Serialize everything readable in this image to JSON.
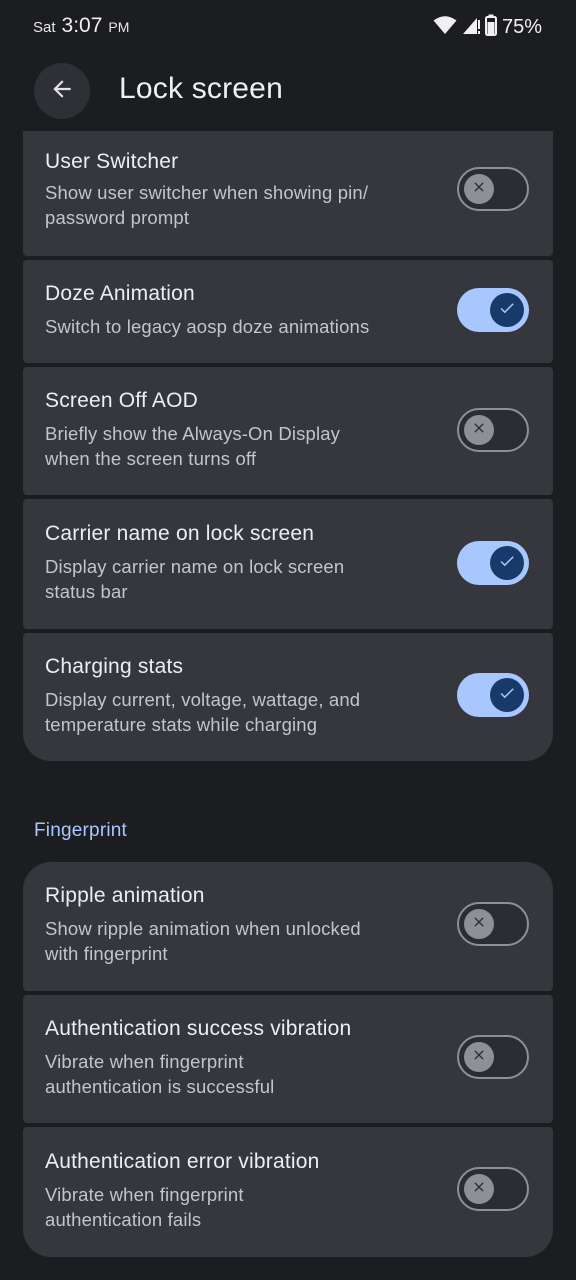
{
  "status_bar": {
    "day": "Sat",
    "time": "3:07",
    "ampm": "PM",
    "battery_percent": "75%",
    "icons": [
      "wifi-icon",
      "signal-icon",
      "battery-icon"
    ]
  },
  "header": {
    "back_icon": "arrow-left-icon",
    "title": "Lock screen"
  },
  "lock_screen_items": [
    {
      "title": "User Switcher",
      "subtitle": "Show user switcher when showing pin/\npassword prompt",
      "enabled": false
    },
    {
      "title": "Doze Animation",
      "subtitle": "Switch to legacy aosp doze animations",
      "enabled": true
    },
    {
      "title": "Screen Off AOD",
      "subtitle": "Briefly show the Always-On Display\nwhen the screen turns off",
      "enabled": false
    },
    {
      "title": "Carrier name on lock screen",
      "subtitle": "Display carrier name on lock screen\nstatus bar",
      "enabled": true
    },
    {
      "title": "Charging stats",
      "subtitle": "Display current, voltage, wattage, and\ntemperature stats while charging",
      "enabled": true
    }
  ],
  "fingerprint_section": {
    "header": "Fingerprint",
    "items": [
      {
        "title": "Ripple animation",
        "subtitle": "Show ripple animation when unlocked\nwith fingerprint",
        "enabled": false
      },
      {
        "title": "Authentication success vibration",
        "subtitle": "Vibrate when fingerprint\nauthentication is successful",
        "enabled": false
      },
      {
        "title": "Authentication error vibration",
        "subtitle": "Vibrate when fingerprint\nauthentication fails",
        "enabled": false
      }
    ]
  },
  "colors": {
    "background": "#1c1d21",
    "card": "#36373d",
    "accent": "#a9c7ff",
    "toggle_on_thumb": "#173a6b",
    "toggle_off": "#8e9097"
  }
}
